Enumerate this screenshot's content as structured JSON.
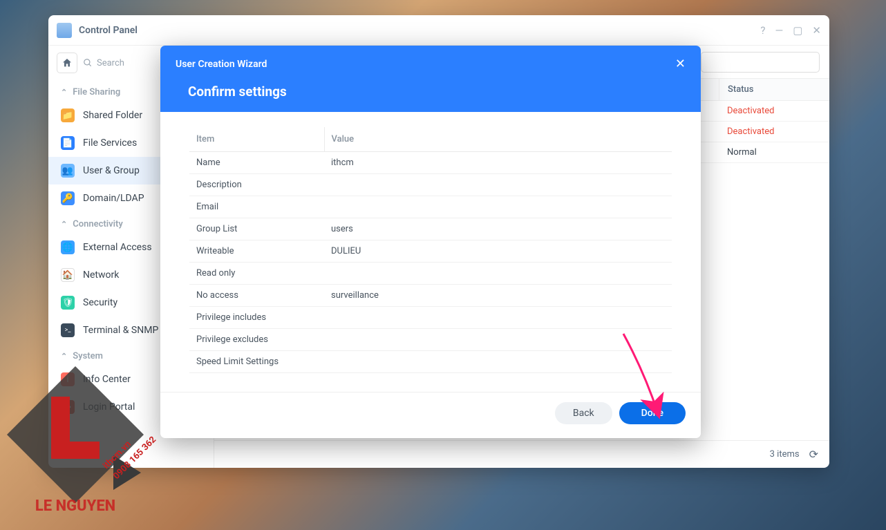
{
  "window": {
    "title": "Control Panel",
    "search_placeholder": "Search"
  },
  "sidebar": {
    "sections": [
      {
        "label": "File Sharing",
        "items": [
          {
            "label": "Shared Folder",
            "icon": "folder"
          },
          {
            "label": "File Services",
            "icon": "fileserv"
          },
          {
            "label": "User & Group",
            "icon": "user",
            "active": true
          },
          {
            "label": "Domain/LDAP",
            "icon": "domain"
          }
        ]
      },
      {
        "label": "Connectivity",
        "items": [
          {
            "label": "External Access",
            "icon": "ext"
          },
          {
            "label": "Network",
            "icon": "net"
          },
          {
            "label": "Security",
            "icon": "sec"
          },
          {
            "label": "Terminal & SNMP",
            "icon": "term"
          }
        ]
      },
      {
        "label": "System",
        "items": [
          {
            "label": "Info Center",
            "icon": "info"
          },
          {
            "label": "Login Portal",
            "icon": "login"
          }
        ]
      }
    ]
  },
  "main": {
    "status_col": "Status",
    "rows": [
      {
        "status": "Deactivated",
        "cls": "deact"
      },
      {
        "status": "Deactivated",
        "cls": "deact"
      },
      {
        "status": "Normal",
        "cls": "normal"
      }
    ],
    "footer_count": "3 items"
  },
  "modal": {
    "title": "User Creation Wizard",
    "heading": "Confirm settings",
    "col_item": "Item",
    "col_value": "Value",
    "rows": [
      {
        "item": "Name",
        "value": "ithcm"
      },
      {
        "item": "Description",
        "value": ""
      },
      {
        "item": "Email",
        "value": ""
      },
      {
        "item": "Group List",
        "value": "users"
      },
      {
        "item": "Writeable",
        "value": "DULIEU"
      },
      {
        "item": "Read only",
        "value": ""
      },
      {
        "item": "No access",
        "value": "surveillance"
      },
      {
        "item": "Privilege includes",
        "value": ""
      },
      {
        "item": "Privilege excludes",
        "value": ""
      },
      {
        "item": "Speed Limit Settings",
        "value": ""
      }
    ],
    "back_label": "Back",
    "done_label": "Done"
  },
  "watermark": {
    "brand": "LE NGUYEN",
    "site": "ithcm.vn",
    "phone": "0908 165 362"
  }
}
